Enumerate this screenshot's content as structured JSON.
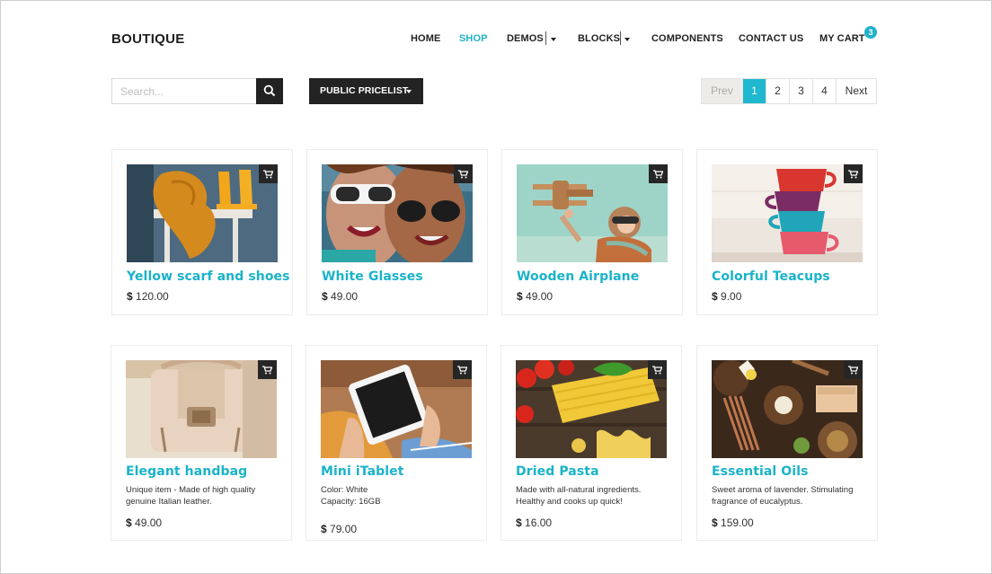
{
  "brand": "BOUTIQUE",
  "nav": {
    "home": "HOME",
    "shop": "SHOP",
    "demos": "DEMOS",
    "blocks": "BLOCKS",
    "components": "COMPONENTS",
    "contact": "CONTACT US",
    "cart": "MY CART",
    "cart_count": "3"
  },
  "search": {
    "placeholder": "Search..."
  },
  "pricelist": {
    "label": "PUBLIC PRICELIST"
  },
  "pager": {
    "prev": "Prev",
    "pages": [
      "1",
      "2",
      "3",
      "4"
    ],
    "active": "1",
    "next": "Next"
  },
  "colors": {
    "accent": "#1fb2c9",
    "dark": "#232323"
  },
  "products": [
    {
      "name": "Yellow scarf and shoes",
      "currency": "$",
      "price": "120.00",
      "desc1": "",
      "desc2": ""
    },
    {
      "name": "White Glasses",
      "currency": "$",
      "price": "49.00",
      "desc1": "",
      "desc2": ""
    },
    {
      "name": "Wooden Airplane",
      "currency": "$",
      "price": "49.00",
      "desc1": "",
      "desc2": ""
    },
    {
      "name": "Colorful Teacups",
      "currency": "$",
      "price": "9.00",
      "desc1": "",
      "desc2": ""
    },
    {
      "name": "Elegant handbag",
      "currency": "$",
      "price": "49.00",
      "desc1": "Unique item - Made of high quality",
      "desc2": "genuine Italian leather."
    },
    {
      "name": "Mini iTablet",
      "currency": "$",
      "price": "79.00",
      "desc1": "Color: White",
      "desc2": "Capacity: 16GB"
    },
    {
      "name": "Dried Pasta",
      "currency": "$",
      "price": "16.00",
      "desc1": "Made with all-natural ingredients.",
      "desc2": "Healthy and cooks up quick!"
    },
    {
      "name": "Essential Oils",
      "currency": "$",
      "price": "159.00",
      "desc1": "Sweet aroma of lavender. Stimulating",
      "desc2": "fragrance of eucalyptus."
    }
  ]
}
